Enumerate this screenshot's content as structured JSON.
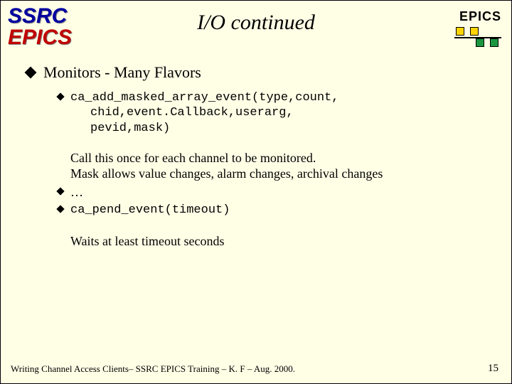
{
  "header": {
    "logo_left_line1": "SSRC",
    "logo_left_line2": "EPICS",
    "title": "I/O continued",
    "logo_right_label": "EPICS"
  },
  "bullets": {
    "main": "Monitors - Many Flavors",
    "code1_line1": "ca_add_masked_array_event(type,count,",
    "code1_line2": "chid,event.Callback,userarg,",
    "code1_line3": "pevid,mask)",
    "desc1_line1": "Call this once for each channel to be monitored.",
    "desc1_line2": "Mask allows value changes, alarm changes, archival changes",
    "ellipsis": "…",
    "code2": "ca_pend_event(timeout)",
    "desc2": "Waits at least timeout seconds"
  },
  "footer": {
    "text": "Writing Channel Access Clients– SSRC EPICS Training – K. F – Aug. 2000.",
    "page": "15"
  }
}
